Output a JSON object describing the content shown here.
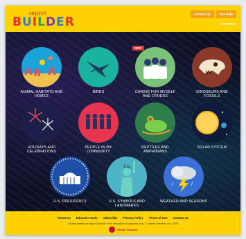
{
  "header": {
    "logo_top": "report",
    "logo_main": "BUILDER",
    "contact_label": "Contact Us",
    "help_label": "Site Help",
    "contact_label_2": "CONTACT"
  },
  "topics": [
    {
      "label": "ANIMAL HABITATS AND HOMES"
    },
    {
      "label": "BIRDS"
    },
    {
      "label": "CARING FOR MYSELF AND OTHERS",
      "badge": "NEW"
    },
    {
      "label": "DINOSAURS AND FOSSILS"
    },
    {
      "label": "HOLIDAYS AND CELEBRATIONS"
    },
    {
      "label": "PEOPLE IN MY COMMUNITY"
    },
    {
      "label": "REPTILES AND AMPHIBIANS"
    },
    {
      "label": "SOLAR SYSTEM"
    },
    {
      "label": "U.S. PRESIDENTS"
    },
    {
      "label": "U.S. SYMBOLS AND LANDMARKS"
    },
    {
      "label": "WEATHER AND SEASONS"
    }
  ],
  "footer": {
    "links": [
      "About Us",
      "Educator Tools",
      "Subscribe",
      "Privacy Policy",
      "Terms of Use",
      "Contact Us"
    ],
    "note": "All information on Report Builder is for educational purposes only. © Gareth Stevens, Inc. 2023",
    "publisher": "Gareth Stevens"
  },
  "colors": {
    "brand_yellow": "#ffd200",
    "button_orange": "#f4a21a",
    "badge_red": "#e4322b"
  }
}
